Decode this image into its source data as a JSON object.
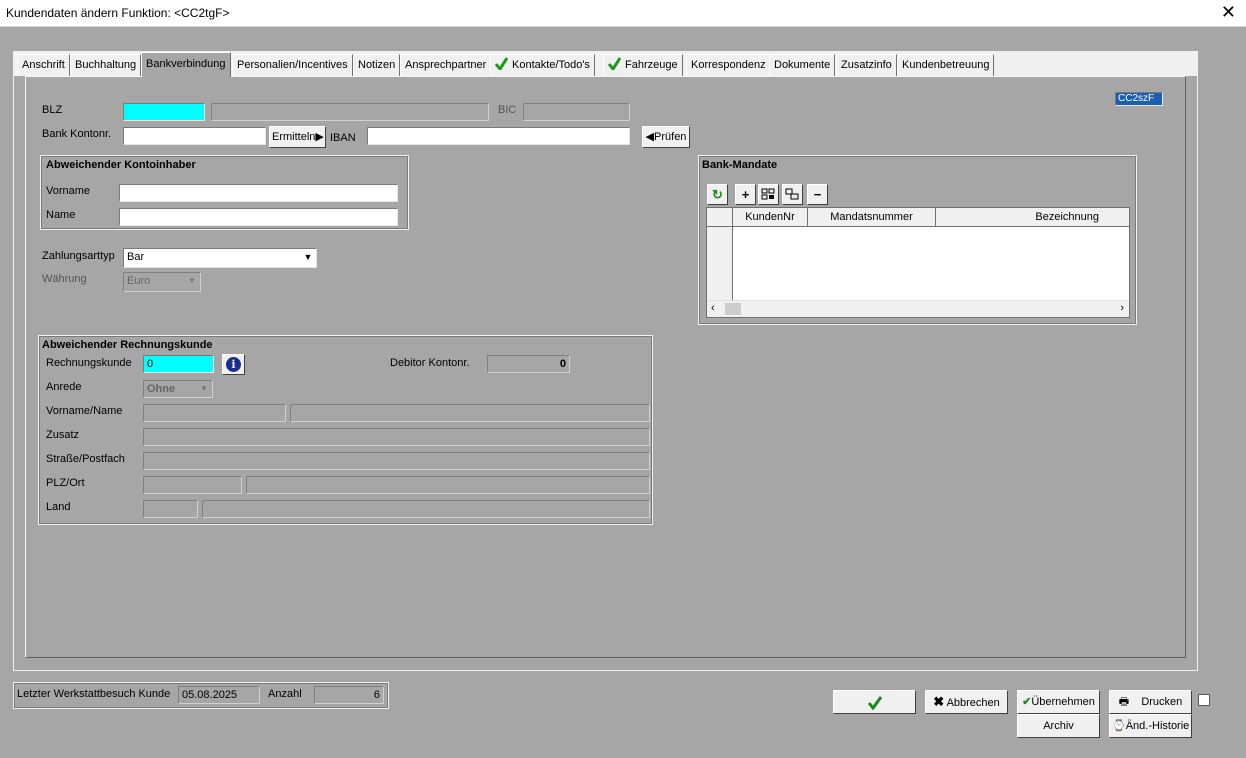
{
  "window": {
    "title": "Kundendaten ändern   Funktion: <CC2tgF>",
    "close": "✕"
  },
  "tabs": [
    {
      "label": "Anschrift"
    },
    {
      "label": "Buchhaltung"
    },
    {
      "label": "Bankverbindung"
    },
    {
      "label": "Personalien/Incentives"
    },
    {
      "label": "Notizen"
    },
    {
      "label": "Ansprechpartner"
    },
    {
      "label": "Kontakte/Todo's"
    },
    {
      "label": "Fahrzeuge"
    },
    {
      "label": "Korrespondenz"
    },
    {
      "label": "Dokumente"
    },
    {
      "label": "Zusatzinfo"
    },
    {
      "label": "Kundenbetreuung"
    }
  ],
  "bank": {
    "blz_label": "BLZ",
    "blz_value": "",
    "bic_label": "BIC",
    "konto_label": "Bank Kontonr.",
    "ermitteln": "Ermitteln",
    "iban_label": "IBAN",
    "pruefen": "Prüfen",
    "code": "CC2szF"
  },
  "inhaber": {
    "title": "Abweichender Kontoinhaber",
    "vorname": "Vorname",
    "name": "Name"
  },
  "zahlung": {
    "label": "Zahlungsarttyp",
    "value": "Bar",
    "waehrung_label": "Währung",
    "waehrung_value": "Euro"
  },
  "mandate": {
    "title": "Bank-Mandate",
    "columns": [
      "KundenNr",
      "Mandatsnummer",
      "Bezeichnung"
    ],
    "toolbar": {
      "refresh": "↻",
      "add": "+",
      "remove": "−"
    }
  },
  "rechnung": {
    "title": "Abweichender Rechnungskunde",
    "kunde_label": "Rechnungskunde",
    "kunde_value": "0",
    "info": "i",
    "debitor_label": "Debitor Kontonr.",
    "debitor_value": "0",
    "anrede_label": "Anrede",
    "anrede_value": "Ohne",
    "vorname_label": "Vorname/Name",
    "zusatz_label": "Zusatz",
    "strasse_label": "Straße/Postfach",
    "plz_label": "PLZ/Ort",
    "land_label": "Land"
  },
  "footer": {
    "werkstatt_label": "Letzter Werkstattbesuch Kunde",
    "werkstatt_value": "05.08.2025",
    "anzahl_label": "Anzahl",
    "anzahl_value": "6",
    "abbrechen": "Abbrechen",
    "uebernehmen": "Übernehmen",
    "drucken": "Drucken",
    "archiv": "Archiv",
    "historie": "Änd.-Historie"
  }
}
